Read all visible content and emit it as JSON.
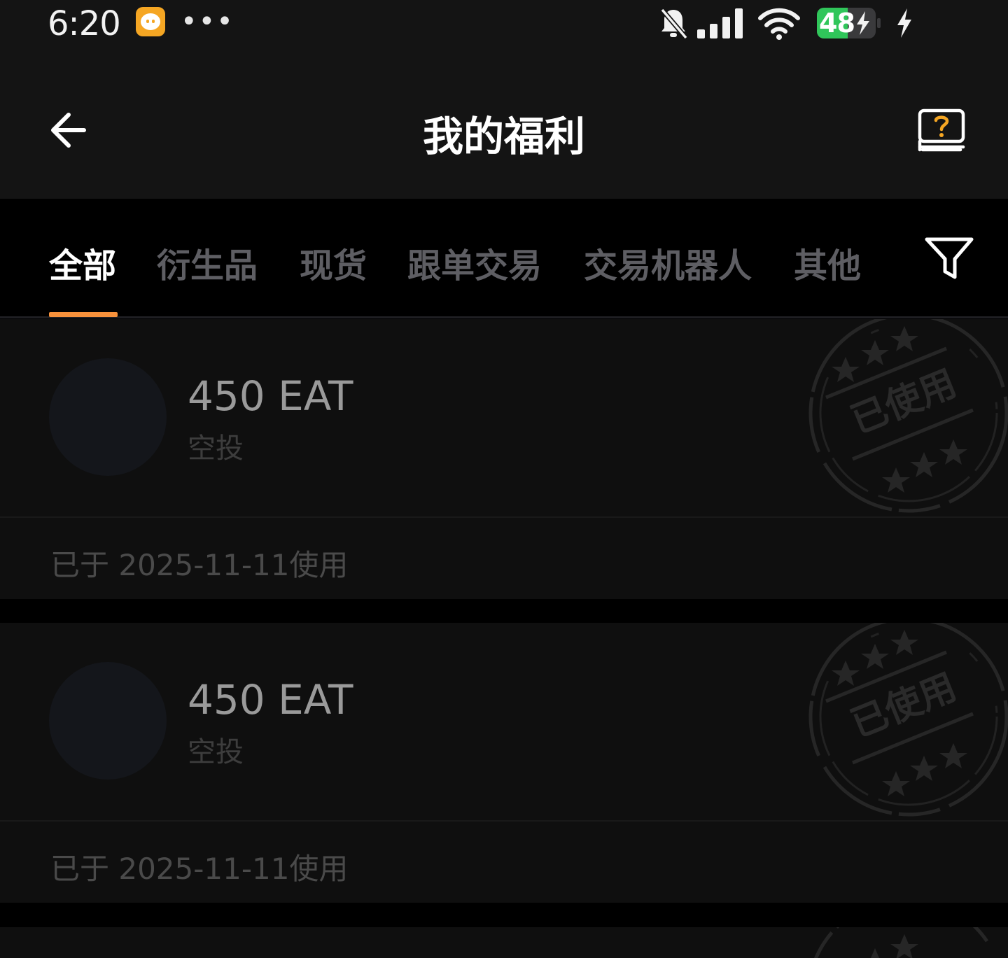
{
  "status_bar": {
    "time": "6:20",
    "battery": "48",
    "icons": [
      "app-badge-icon",
      "more-dots-icon",
      "mute-bell-icon",
      "signal-icon",
      "wifi-icon",
      "battery-icon",
      "charging-icon"
    ]
  },
  "header": {
    "title": "我的福利"
  },
  "tabs": [
    {
      "label": "全部"
    },
    {
      "label": "衍生品"
    },
    {
      "label": "现货"
    },
    {
      "label": "跟单交易"
    },
    {
      "label": "交易机器人"
    },
    {
      "label": "其他"
    }
  ],
  "active_tab": "全部",
  "cards": [
    {
      "amount": "450 EAT",
      "type": "空投",
      "stamp": "已使用",
      "used_text": "已于 2025-11-11使用"
    },
    {
      "amount": "450 EAT",
      "type": "空投",
      "stamp": "已使用",
      "used_text": "已于 2025-11-11使用"
    }
  ],
  "colors": {
    "accent": "#f7913b",
    "background": "#000000",
    "card": "#0f0f0f",
    "header": "#141414",
    "battery_green": "#30c65a"
  }
}
